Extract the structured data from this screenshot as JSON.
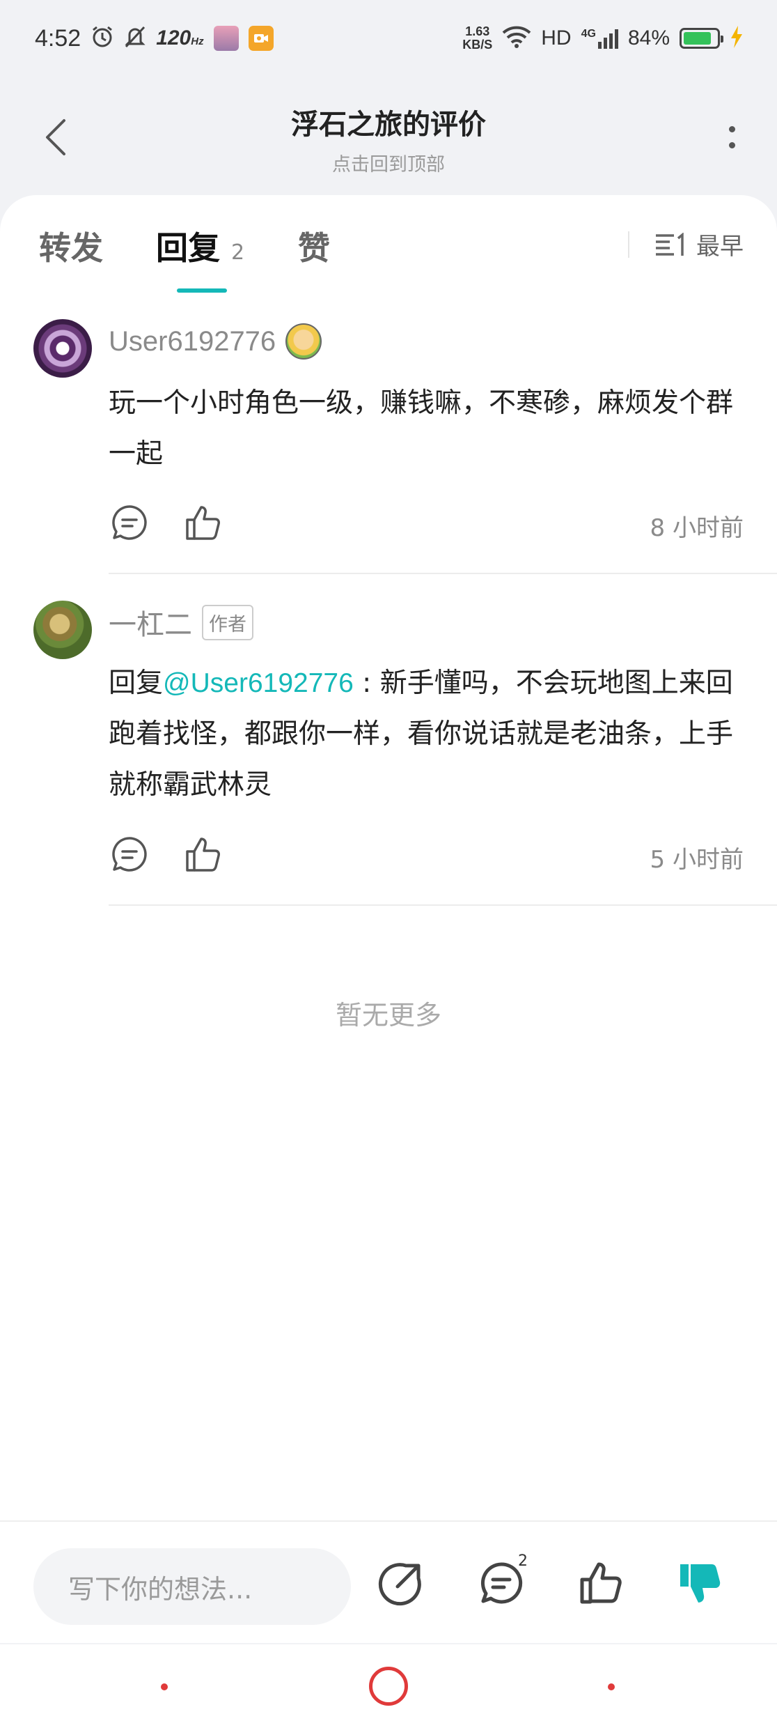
{
  "status_bar": {
    "time": "4:52",
    "refresh_rate": "120",
    "refresh_unit": "Hz",
    "net_speed_value": "1.63",
    "net_speed_unit": "KB/S",
    "hd": "HD",
    "network": "4G",
    "battery_percent": "84%",
    "battery_level": 0.84,
    "icons": [
      "alarm-icon",
      "silent-icon",
      "app-icon",
      "recorder-icon",
      "wifi-icon",
      "signal-icon",
      "battery-icon",
      "charging-icon"
    ]
  },
  "header": {
    "title": "浮石之旅的评价",
    "subtitle": "点击回到顶部"
  },
  "tabs": {
    "forward": "转发",
    "reply": "回复",
    "reply_count": "2",
    "like": "赞",
    "sort_label": "最早"
  },
  "comments": [
    {
      "username": "User6192776",
      "text": "玩一个小时角色一级，赚钱嘛，不寒碜，麻烦发个群一起",
      "time": "8 小时前"
    },
    {
      "username": "一杠二",
      "author_tag": "作者",
      "reply_prefix": "回复",
      "mention": "@User6192776",
      "text": " : 新手懂吗，不会玩地图上来回跑着找怪，都跟你一样，看你说话就是老油条，上手就称霸武林灵",
      "time": "5 小时前"
    }
  ],
  "list_end": "暂无更多",
  "bottom_bar": {
    "input_placeholder": "写下你的想法...",
    "comment_count": "2"
  },
  "colors": {
    "accent": "#14b8b8",
    "text_primary": "#222222",
    "text_secondary": "#8a8a8a",
    "nav": "#e03a3a"
  }
}
